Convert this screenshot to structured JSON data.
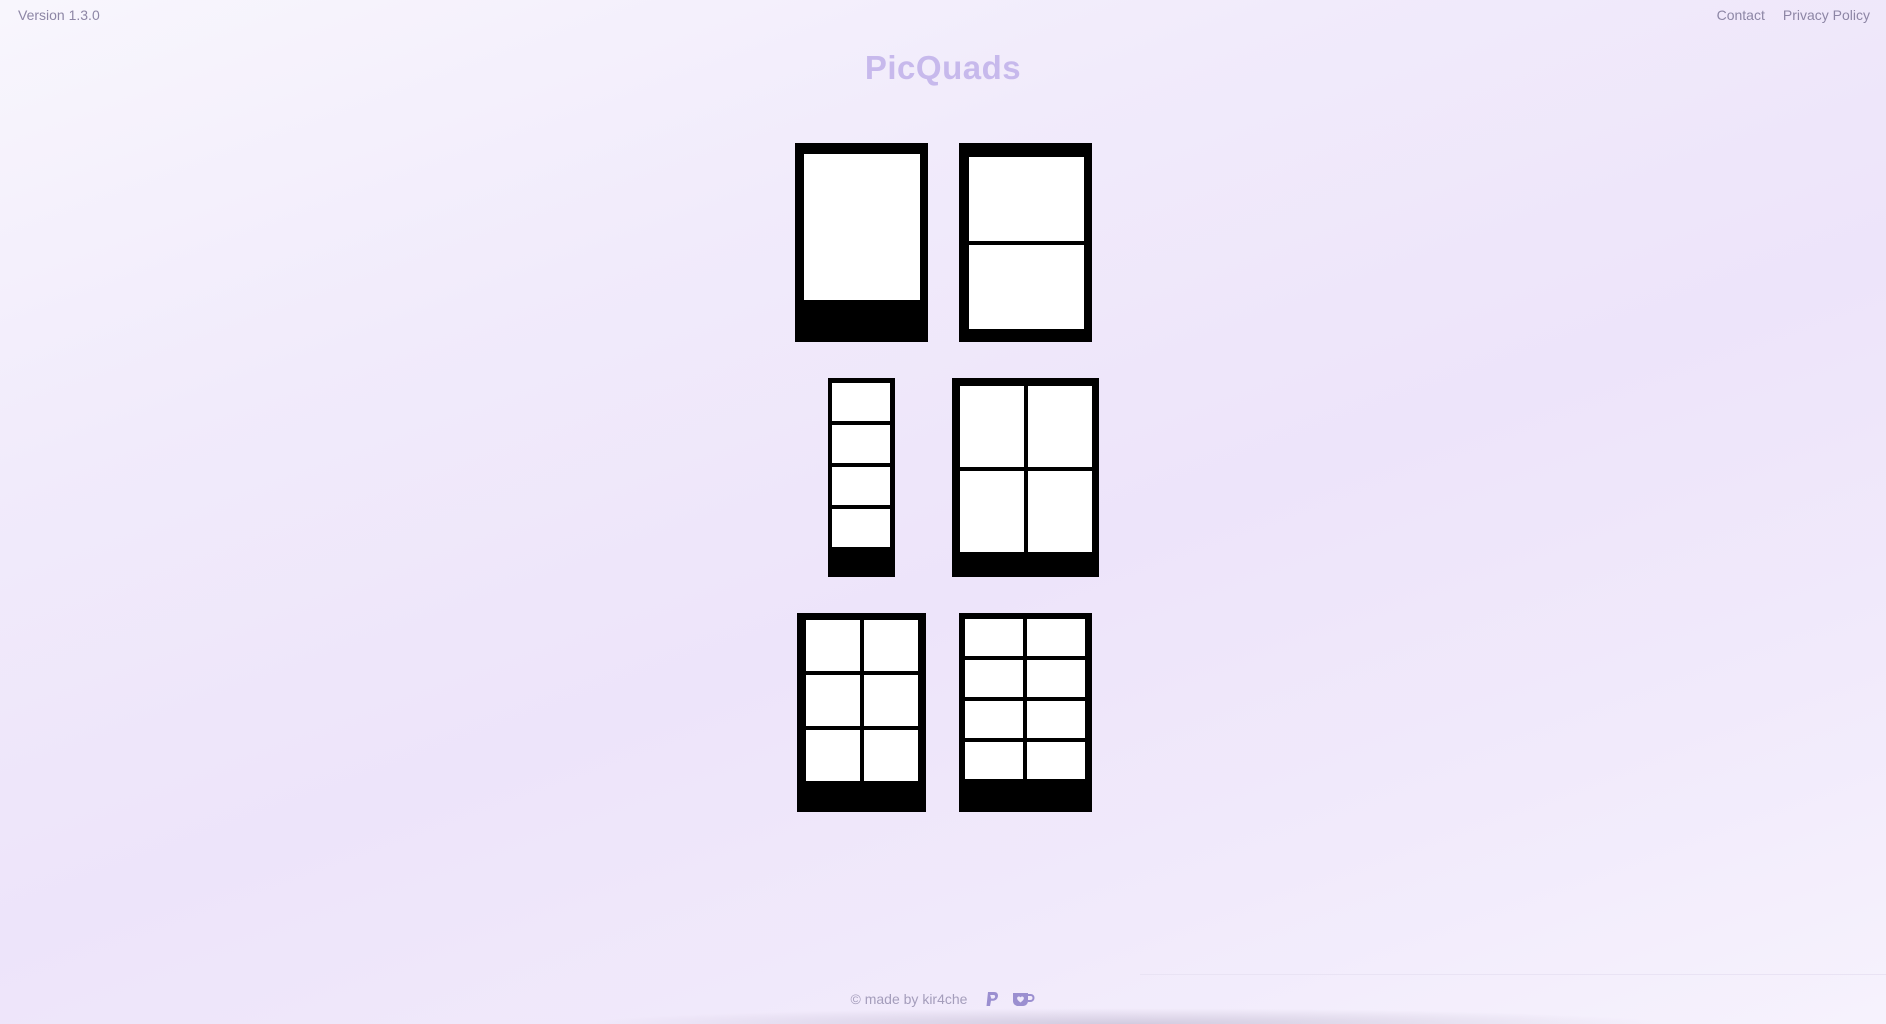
{
  "header": {
    "version": "Version 1.3.0",
    "links": [
      "Contact",
      "Privacy Policy"
    ]
  },
  "title": "PicQuads",
  "layouts": [
    {
      "id": "single",
      "rows": 1,
      "cols": 1
    },
    {
      "id": "two-stack",
      "rows": 2,
      "cols": 1
    },
    {
      "id": "four-strip",
      "rows": 4,
      "cols": 1
    },
    {
      "id": "grid-2x2",
      "rows": 2,
      "cols": 2
    },
    {
      "id": "grid-3x2",
      "rows": 3,
      "cols": 2
    },
    {
      "id": "grid-4x2",
      "rows": 4,
      "cols": 2
    }
  ],
  "footer": {
    "credit": "© made by kir4che",
    "icons": [
      "paypal-icon",
      "coffee-cup-icon"
    ]
  }
}
